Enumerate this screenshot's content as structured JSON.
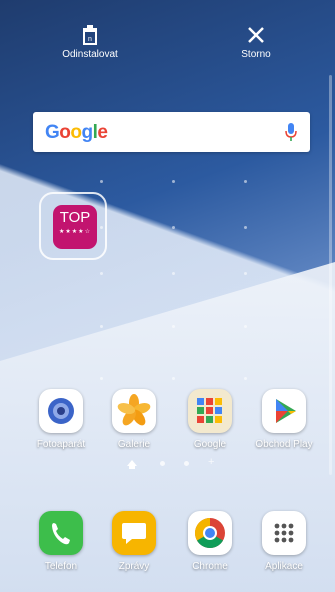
{
  "top_actions": {
    "uninstall_label": "Odinstalovat",
    "cancel_label": "Storno",
    "uninstall_icon": "trash-icon",
    "cancel_icon": "close-icon"
  },
  "search_widget": {
    "logo": "Google",
    "mic_icon": "microphone-icon",
    "colors": [
      "#4285F4",
      "#EA4335",
      "#FBBC05",
      "#4285F4",
      "#34A853",
      "#EA4335"
    ]
  },
  "selected_widget": {
    "label": "TOP",
    "stars": "★★★★☆",
    "color": "#C2146F"
  },
  "apps": [
    {
      "label": "Fotoaparát",
      "icon": "camera-icon",
      "color": "#FFFFFF"
    },
    {
      "label": "Galerie",
      "icon": "gallery-flower-icon",
      "color": "#FFFFFF"
    },
    {
      "label": "Google",
      "icon": "google-folder-icon",
      "color": "#F3E9CE"
    },
    {
      "label": "Obchod Play",
      "icon": "play-store-icon",
      "color": "#FFFFFF"
    }
  ],
  "dock": [
    {
      "label": "Telefon",
      "icon": "phone-icon",
      "color": "#3DBE4B"
    },
    {
      "label": "Zprávy",
      "icon": "messages-icon",
      "color": "#F7B500"
    },
    {
      "label": "Chrome",
      "icon": "chrome-icon",
      "color": "#FFFFFF"
    },
    {
      "label": "Aplikace",
      "icon": "apps-grid-icon",
      "color": "#FFFFFF"
    }
  ],
  "pager": {
    "plus": "+"
  }
}
